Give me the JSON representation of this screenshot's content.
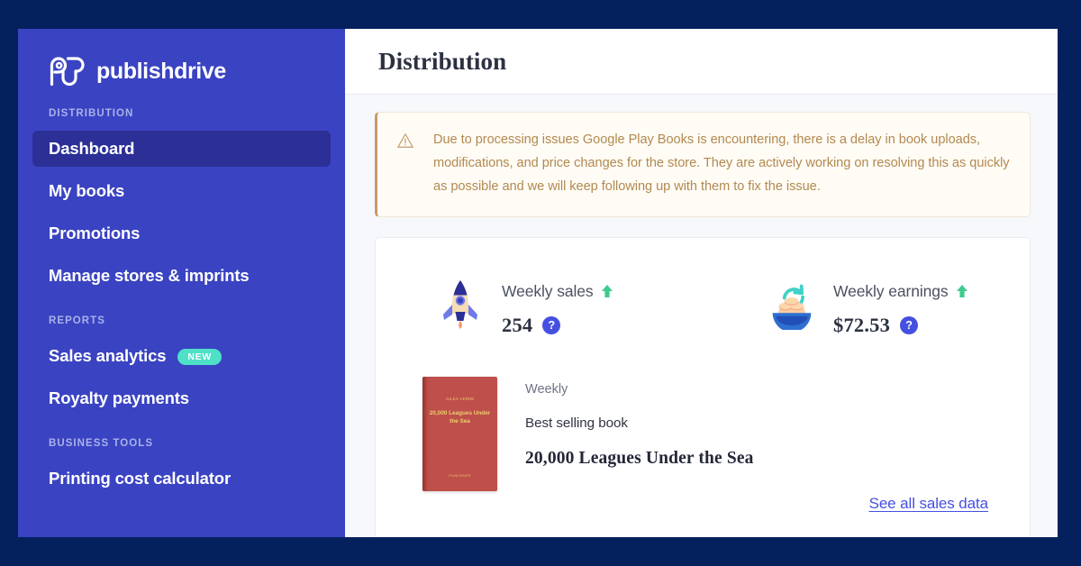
{
  "theme": {
    "page_background": "#04215e",
    "sidebar_background": "#3a43c2",
    "sidebar_active": "#2b2f96",
    "accent_blue": "#4550e0",
    "badge_teal": "#4fe0c8",
    "alert_text": "#b2894f",
    "alert_background": "#fffcf6",
    "alert_border": "#c99a6a",
    "arrow_up_green": "#3ecb8e"
  },
  "sidebar": {
    "logo": {
      "icon": "publishdrive-logo-icon",
      "text": "publishdrive"
    },
    "sections": [
      {
        "label": "DISTRIBUTION",
        "items": [
          {
            "label": "Dashboard",
            "active": true,
            "badge": null
          },
          {
            "label": "My books",
            "active": false,
            "badge": null
          },
          {
            "label": "Promotions",
            "active": false,
            "badge": null
          },
          {
            "label": "Manage stores & imprints",
            "active": false,
            "badge": null
          }
        ]
      },
      {
        "label": "REPORTS",
        "items": [
          {
            "label": "Sales analytics",
            "active": false,
            "badge": "NEW"
          },
          {
            "label": "Royalty payments",
            "active": false,
            "badge": null
          }
        ]
      },
      {
        "label": "BUSINESS TOOLS",
        "items": [
          {
            "label": "Printing cost calculator",
            "active": false,
            "badge": null
          }
        ]
      }
    ]
  },
  "header": {
    "title": "Distribution"
  },
  "alert": {
    "icon": "warning-triangle-icon",
    "message": "Due to processing issues Google Play Books is encountering, there is a delay in book uploads, modifications, and price changes for the store. They are actively working on resolving this as quickly as possible and we will keep following up with them to fix the issue."
  },
  "stats": {
    "sales": {
      "icon": "rocket-icon",
      "label": "Weekly sales",
      "trend": "up",
      "value": "254",
      "help": "?"
    },
    "earnings": {
      "icon": "coins-refresh-icon",
      "label": "Weekly earnings",
      "trend": "up",
      "value": "$72.53",
      "help": "?"
    }
  },
  "best_seller": {
    "period": "Weekly",
    "caption": "Best selling book",
    "title": "20,000 Leagues Under the Sea",
    "cover": {
      "author": "JULES VERNE",
      "title": "20,000 Leagues Under the Sea",
      "publisher": "PUBLISHER"
    }
  },
  "footer": {
    "see_all_label": "See all sales data"
  }
}
